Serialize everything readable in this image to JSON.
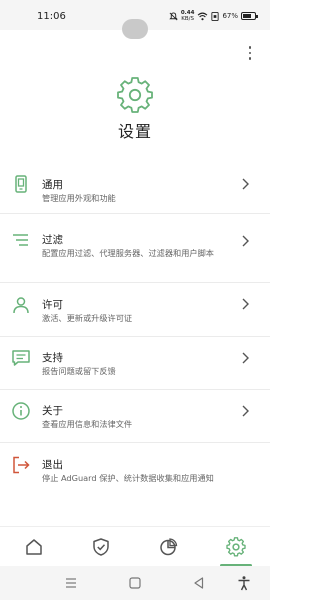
{
  "status_bar": {
    "time": "11:06",
    "net_speed_value": "0.44",
    "net_speed_unit": "KB/S",
    "battery": "67%",
    "icons": [
      "mute-icon",
      "wifi-icon",
      "sim-icon",
      "battery-icon"
    ]
  },
  "page": {
    "title": "设置",
    "header_icon": "gear-icon",
    "more_icon": "more-vertical-icon"
  },
  "menu": {
    "items": [
      {
        "title": "通用",
        "subtitle": "管理应用外观和功能",
        "icon": "phone-icon",
        "icon_color": "#67b279"
      },
      {
        "title": "过滤",
        "subtitle": "配置应用过滤、代理服务器、过滤器和用户脚本",
        "icon": "filter-lines-icon",
        "icon_color": "#67b279"
      },
      {
        "title": "许可",
        "subtitle": "激活、更新或升级许可证",
        "icon": "person-icon",
        "icon_color": "#67b279"
      },
      {
        "title": "支持",
        "subtitle": "报告问题或留下反馈",
        "icon": "chat-icon",
        "icon_color": "#67b279"
      },
      {
        "title": "关于",
        "subtitle": "查看应用信息和法律文件",
        "icon": "info-icon",
        "icon_color": "#67b279"
      },
      {
        "title": "退出",
        "subtitle": "停止 AdGuard 保护、统计数据收集和应用通知",
        "icon": "exit-icon",
        "icon_color": "#d0563a"
      }
    ]
  },
  "bottom_nav": {
    "tabs": [
      "home-icon",
      "shield-check-icon",
      "statistics-icon",
      "settings-icon"
    ],
    "active_index": 3,
    "accent": "#67b279",
    "inactive": "#555555"
  },
  "system_nav": {
    "buttons": [
      "menu-icon",
      "home-square-icon",
      "back-triangle-icon",
      "accessibility-icon"
    ]
  }
}
